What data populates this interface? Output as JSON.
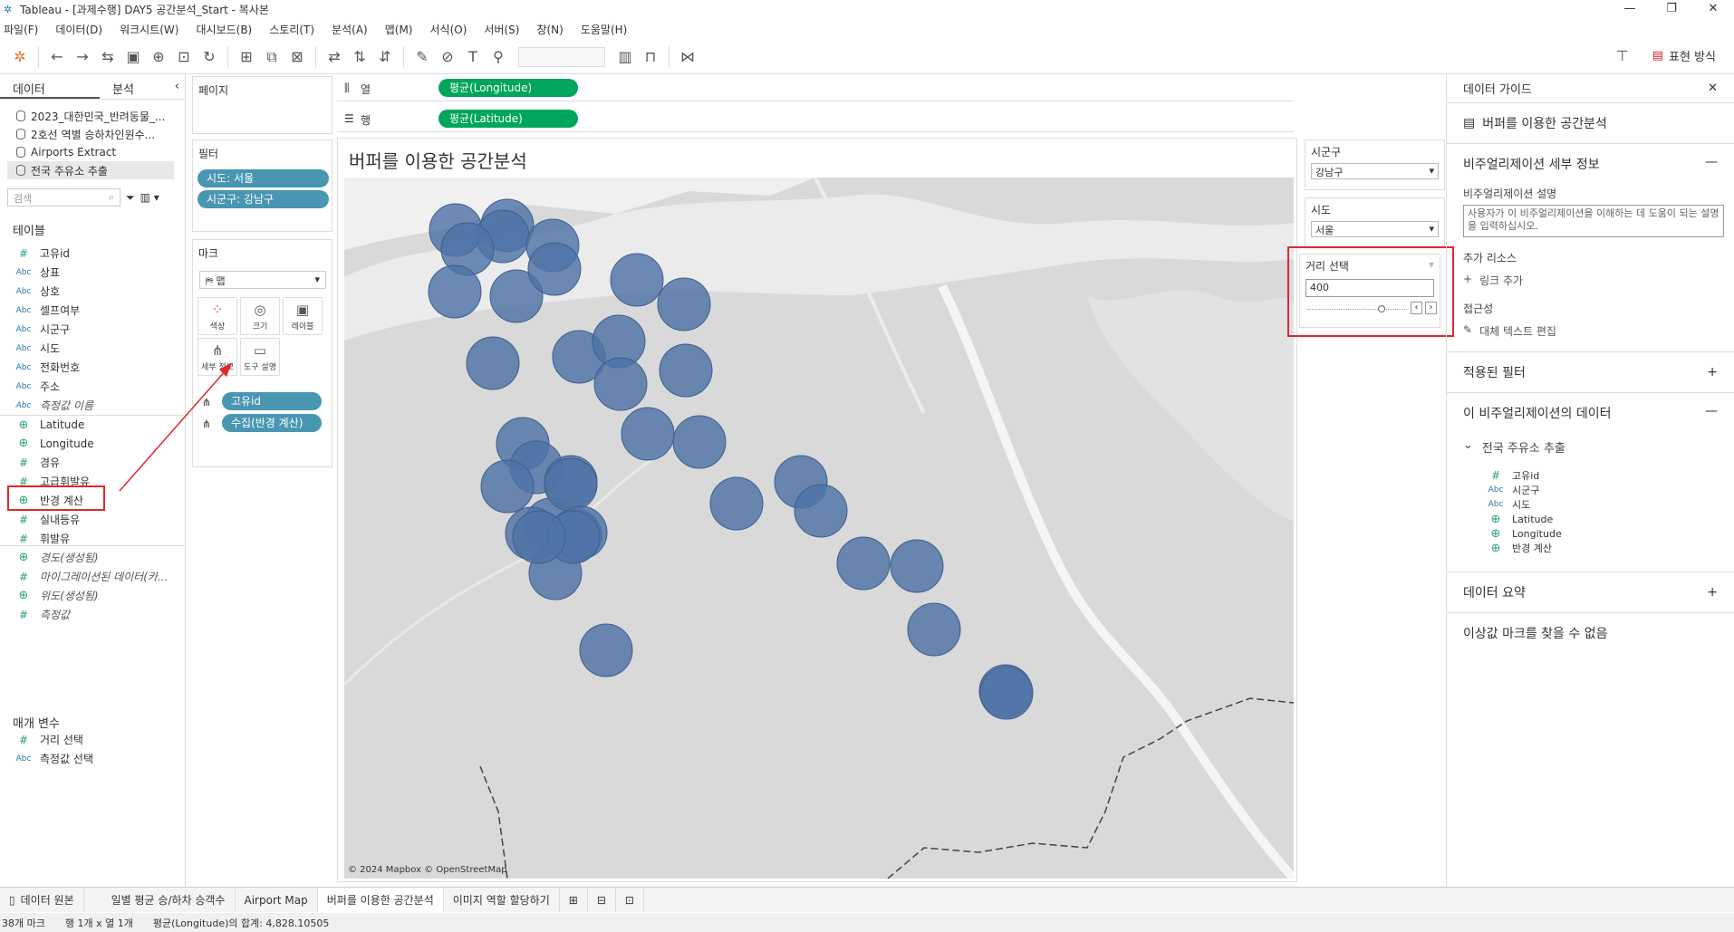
{
  "window": {
    "title": "Tableau - [과제수행] DAY5 공간분석_Start - 복사본"
  },
  "menu": [
    "파일(F)",
    "데이터(D)",
    "워크시트(W)",
    "대시보드(B)",
    "스토리(T)",
    "분석(A)",
    "맵(M)",
    "서식(O)",
    "서버(S)",
    "창(N)",
    "도움말(H)"
  ],
  "toolbar": {
    "show_me": "표현 방식"
  },
  "data_pane": {
    "tabs": [
      "데이터",
      "분석"
    ],
    "sources": [
      "2023_대한민국_반려동물_...",
      "2호선 역별 승하차인원수...",
      "Airports Extract",
      "전국 주유소 추출"
    ],
    "search_placeholder": "검색",
    "tables_header": "테이블",
    "fields": [
      {
        "type": "hash",
        "name": "고유id"
      },
      {
        "type": "abc",
        "name": "상표"
      },
      {
        "type": "abc",
        "name": "상호"
      },
      {
        "type": "abc",
        "name": "셀프여부"
      },
      {
        "type": "abc",
        "name": "시군구"
      },
      {
        "type": "abc",
        "name": "시도"
      },
      {
        "type": "abc",
        "name": "전화번호"
      },
      {
        "type": "abc",
        "name": "주소"
      },
      {
        "type": "abc",
        "name": "측정값 이름"
      },
      {
        "type": "glb",
        "name": "Latitude"
      },
      {
        "type": "glb",
        "name": "Longitude"
      },
      {
        "type": "hash",
        "name": "경유"
      },
      {
        "type": "hash",
        "name": "고급휘발유"
      },
      {
        "type": "glb",
        "name": "반경 계산"
      },
      {
        "type": "hash",
        "name": "실내등유"
      },
      {
        "type": "hash",
        "name": "휘발유"
      },
      {
        "type": "glb",
        "name": "경도(생성됨)"
      },
      {
        "type": "hash",
        "name": "마이그레이션된 데이터(카..."
      },
      {
        "type": "glb",
        "name": "위도(생성됨)"
      },
      {
        "type": "hash",
        "name": "측정값"
      }
    ],
    "params_header": "매개 변수",
    "params": [
      {
        "type": "hash",
        "name": "거리 선택"
      },
      {
        "type": "abc",
        "name": "측정값 선택"
      }
    ]
  },
  "shelves": {
    "pages": "페이지",
    "filters": "필터",
    "filter_pills": [
      "시도: 서울",
      "시군구: 강남구"
    ],
    "marks": "마크",
    "mark_type": "맵",
    "mark_buttons": [
      "색상",
      "크기",
      "레이블",
      "세부 정보",
      "도구 설명"
    ],
    "mark_pills": [
      "고유id",
      "수집(반경 계산)"
    ],
    "columns_label": "열",
    "rows_label": "행",
    "columns_pill": "평균(Longitude)",
    "rows_pill": "평균(Latitude)"
  },
  "view": {
    "title": "버퍼를 이용한 공간분석",
    "attribution": "© 2024 Mapbox © OpenStreetMap",
    "circle_color": "#4e73a6"
  },
  "quick_filters": {
    "sigungu_label": "시군구",
    "sigungu_value": "강남구",
    "sido_label": "시도",
    "sido_value": "서울",
    "distance_label": "거리 선택",
    "distance_value": "400"
  },
  "guide": {
    "title": "데이터 가이드",
    "viz_name": "버퍼를 이용한 공간분석",
    "details": "비주얼리제이션 세부 정보",
    "desc_label": "비주얼리제이션 설명",
    "desc_placeholder": "사용자가 이 비주얼리제이션을 이해하는 데 도움이 되는 설명을 입력하십시오.",
    "resources": "추가 리소스",
    "add_link": "링크 추가",
    "access": "접근성",
    "alt_text": "대체 텍스트 편집",
    "applied_filters": "적용된 필터",
    "viz_data": "이 비주얼리제이션의 데이터",
    "source": "전국 주유소 추출",
    "source_fields": [
      {
        "type": "hash",
        "name": "고유id"
      },
      {
        "type": "abc",
        "name": "시군구"
      },
      {
        "type": "abc",
        "name": "시도"
      },
      {
        "type": "glb",
        "name": "Latitude"
      },
      {
        "type": "glb",
        "name": "Longitude"
      },
      {
        "type": "glb",
        "name": "반경 계산"
      }
    ],
    "summary": "데이터 요약",
    "outliers": "이상값 마크를 찾을 수 없음"
  },
  "tabs": [
    "데이터 원본",
    "일별 평균 승/하차 승객수",
    "Airport Map",
    "버퍼를 이용한 공간분석",
    "이미지 역할 할당하기"
  ],
  "status": {
    "marks": "38개 마크",
    "rows_cols": "행 1개 x 열 1개",
    "sum": "평균(Longitude)의 합계: 4,828.10505"
  }
}
